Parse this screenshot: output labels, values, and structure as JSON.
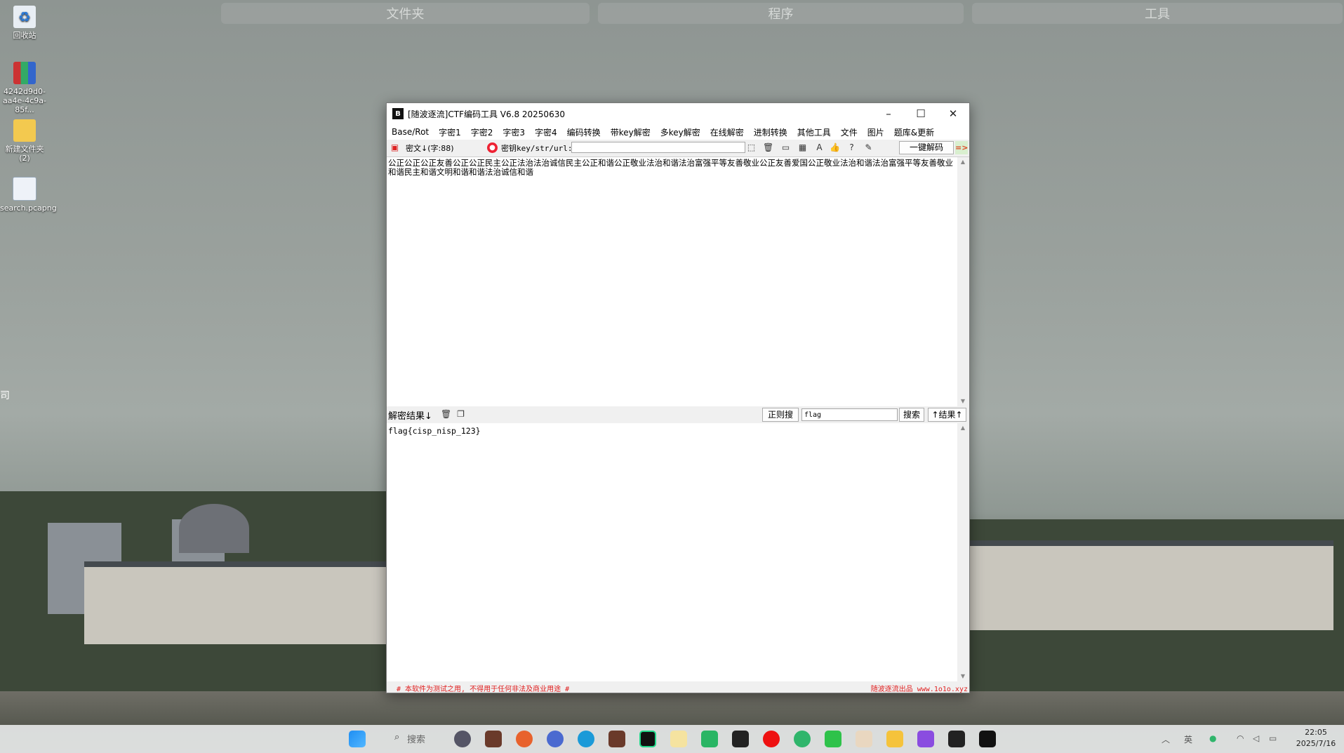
{
  "launcher": {
    "folders": "文件夹",
    "programs": "程序",
    "tools": "工具"
  },
  "desktop": {
    "icons": [
      {
        "label": "回收站",
        "icon": "recycle-bin-icon"
      },
      {
        "label": "4242d9d0-aa4e-4c9a-85f...",
        "icon": "winrar-archive-icon"
      },
      {
        "label": "新建文件夹 (2)",
        "icon": "folder-icon"
      },
      {
        "label": "search.pcapng",
        "icon": "pcap-file-icon"
      }
    ],
    "edge_char": "司"
  },
  "window": {
    "title": "[随波逐流]CTF编码工具 V6.8  20250630",
    "app_icon_text": "B",
    "controls": {
      "minimize": "–",
      "maximize": "☐",
      "close": "✕"
    },
    "menu": [
      "Base/Rot",
      "字密1",
      "字密2",
      "字密3",
      "字密4",
      "编码转换",
      "带key解密",
      "多key解密",
      "在线解密",
      "进制转换",
      "其他工具",
      "文件",
      "图片",
      "题库&更新"
    ],
    "toolbar": {
      "cipher_label": "密文↓(字:88)",
      "key_label": "密钥key/str/url:",
      "key_value": "",
      "decode_all": "一键解码",
      "arrow": "=>"
    },
    "cipher_text": "公正公正公正友善公正公正民主公正法治法治诚信民主公正和谐公正敬业法治和谐法治富强平等友善敬业公正友善爱国公正敬业法治和谐法治富强平等友善敬业和谐民主和谐文明和谐和谐法治诚信和谐",
    "result_bar": {
      "label": "解密结果↓",
      "regex_button": "正则搜",
      "search_value": "flag",
      "search_button": "搜索",
      "result_up_button": "↑结果↑"
    },
    "result_text": "flag{cisp_nisp_123}",
    "status": {
      "left": "# 本软件为测试之用, 不得用于任何非法及商业用途 #",
      "right": "随波逐流出品 www.1o1o.xyz"
    }
  },
  "taskbar": {
    "search_label": "搜索",
    "tray_ime": "英",
    "time": "22:05",
    "date": "2025/7/16"
  }
}
